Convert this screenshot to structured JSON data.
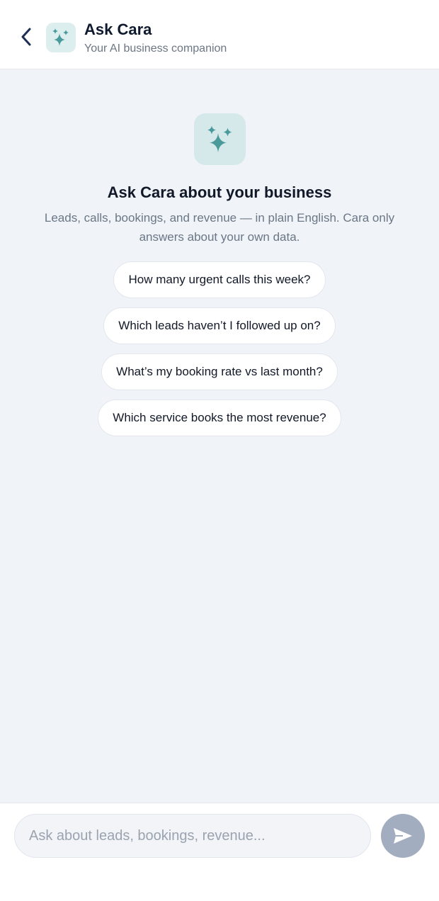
{
  "colors": {
    "accent": "#4a9a9c",
    "icon_bg": "#dceeee",
    "page_bg": "#f0f3f8",
    "send_disabled": "#a3adc0"
  },
  "header": {
    "back_icon": "chevron-left-icon",
    "avatar_icon": "sparkles-icon",
    "title": "Ask Cara",
    "subtitle": "Your AI business companion"
  },
  "hero": {
    "icon": "sparkles-icon",
    "title": "Ask Cara about your business",
    "description": "Leads, calls, bookings, and revenue — in plain English. Cara only answers about your own data."
  },
  "suggestions": [
    "How many urgent calls this week?",
    "Which leads haven’t I followed up on?",
    "What’s my booking rate vs last month?",
    "Which service books the most revenue?"
  ],
  "composer": {
    "placeholder": "Ask about leads, bookings, revenue...",
    "value": "",
    "send_icon": "send-icon"
  }
}
